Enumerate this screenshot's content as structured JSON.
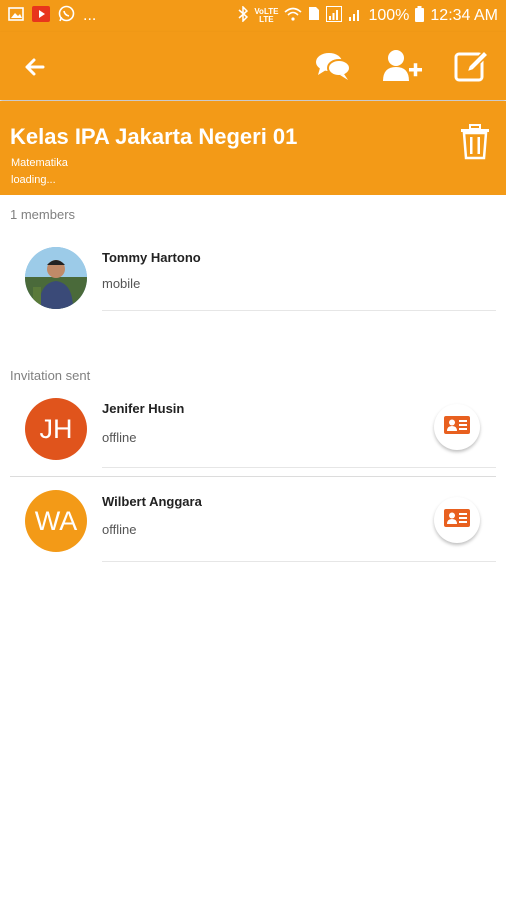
{
  "status_bar": {
    "left_text": "...",
    "net_label_top": "VoLTE",
    "net_label_bottom": "LTE",
    "battery": "100%",
    "time": "12:34 AM"
  },
  "app_bar": {
    "back_icon": "arrow-left-icon",
    "actions": [
      "chat-icon",
      "add-user-icon",
      "edit-icon"
    ]
  },
  "header": {
    "title": "Kelas IPA Jakarta Negeri 01",
    "subject": "Matematika",
    "status": "loading...",
    "delete_icon": "trash-icon"
  },
  "members_section": {
    "label": "1 members",
    "items": [
      {
        "name": "Tommy Hartono",
        "status": "mobile"
      }
    ]
  },
  "invitations_section": {
    "label": "Invitation sent",
    "items": [
      {
        "initials": "JH",
        "name": "Jenifer Husin",
        "status": "offline",
        "color": "#e0541c"
      },
      {
        "initials": "WA",
        "name": "Wilbert Anggara",
        "status": "offline",
        "color": "#f39a17"
      }
    ]
  },
  "colors": {
    "primary": "#f39a17",
    "accent": "#e8601f"
  }
}
